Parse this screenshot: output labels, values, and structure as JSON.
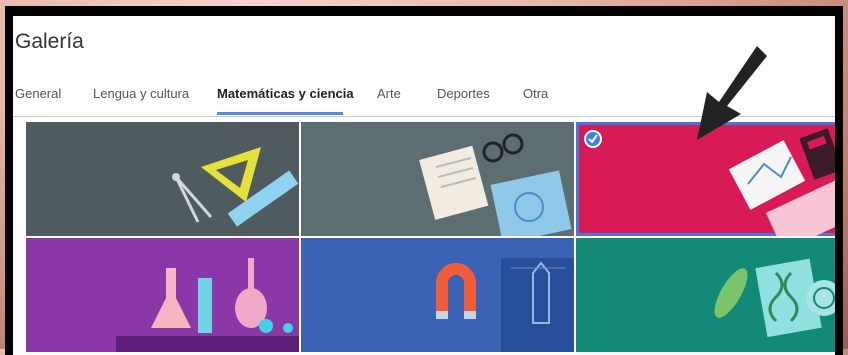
{
  "window": {
    "title": "Galería"
  },
  "tabs": [
    {
      "label": "General"
    },
    {
      "label": "Lengua y cultura"
    },
    {
      "label": "Matemáticas y ciencia"
    },
    {
      "label": "Arte"
    },
    {
      "label": "Deportes"
    },
    {
      "label": "Otra"
    }
  ],
  "active_tab": "Matemáticas y ciencia",
  "tiles": [
    {
      "theme": "geometry-tools",
      "icon": "set-square-compass-ruler-icon",
      "color": "#4f5b5e",
      "selected": false
    },
    {
      "theme": "notes-glasses-brain",
      "icon": "notebook-glasses-icon",
      "color": "#5d6e73",
      "selected": false
    },
    {
      "theme": "graph-calculator",
      "icon": "graph-calculator-icon",
      "color": "#d81b57",
      "selected": true
    },
    {
      "theme": "chemistry-flasks",
      "icon": "flask-icon",
      "color": "#8a37a8",
      "selected": false
    },
    {
      "theme": "magnet-rocket",
      "icon": "magnet-rocket-icon",
      "color": "#3b63b5",
      "selected": false
    },
    {
      "theme": "dna-biology",
      "icon": "dna-leaf-icon",
      "color": "#138a77",
      "selected": false
    }
  ],
  "colors": {
    "accent": "#5b8bd8",
    "selection": "#4a76d4",
    "arrow": "#222222"
  }
}
